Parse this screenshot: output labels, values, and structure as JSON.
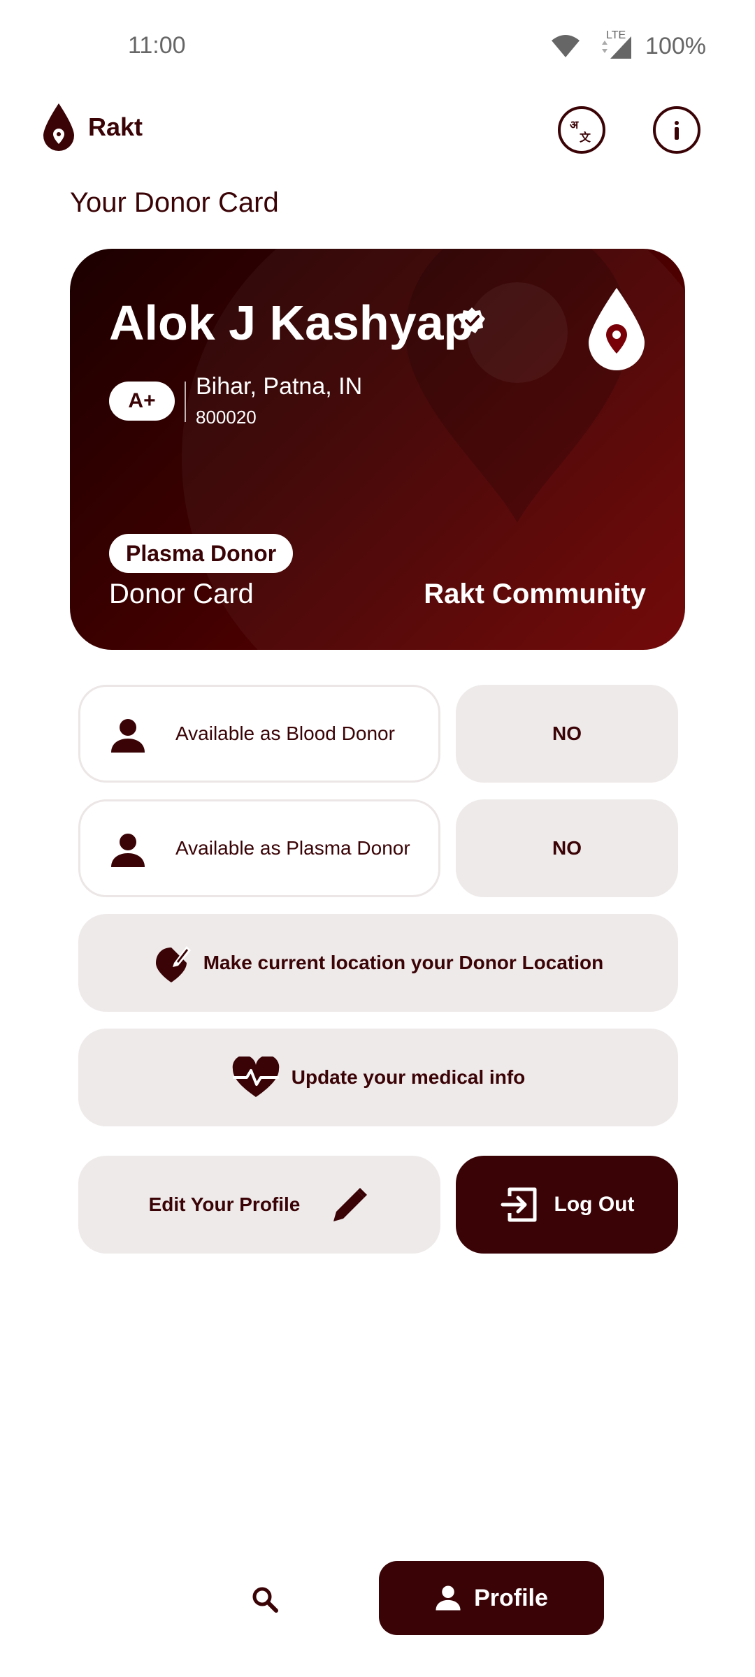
{
  "status_bar": {
    "time": "11:00",
    "network": "LTE",
    "battery": "100%"
  },
  "header": {
    "app_name": "Rakt"
  },
  "section_title": "Your Donor Card",
  "donor_card": {
    "name": "Alok J Kashyap",
    "blood_group": "A+",
    "location": "Bihar, Patna, IN",
    "pincode": "800020",
    "donor_type": "Plasma Donor",
    "card_label": "Donor Card",
    "community": "Rakt Community"
  },
  "availability": [
    {
      "label": "Available as Blood Donor",
      "value": "NO"
    },
    {
      "label": "Available as Plasma Donor",
      "value": "NO"
    }
  ],
  "actions": {
    "donor_location": "Make current location your Donor Location",
    "medical_info": "Update your medical info",
    "edit_profile": "Edit Your Profile",
    "logout": "Log Out"
  },
  "bottom_nav": {
    "profile_label": "Profile"
  },
  "colors": {
    "primary": "#3a0306",
    "button_bg": "#efeaea",
    "card_accent": "#6e0000"
  }
}
